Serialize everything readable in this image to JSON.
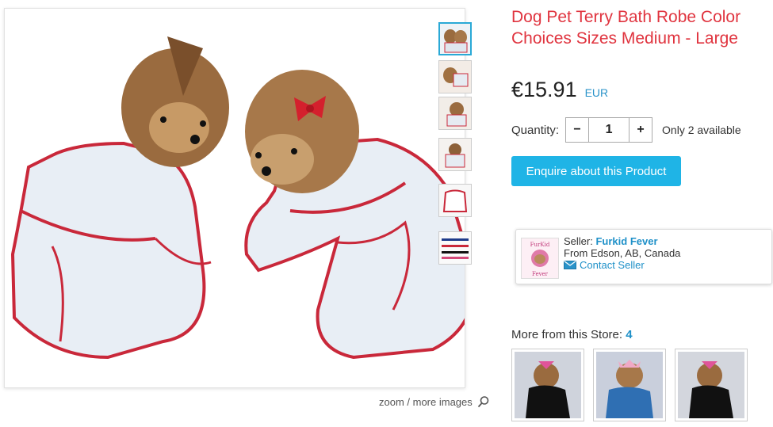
{
  "product": {
    "title": "Dog Pet Terry Bath Robe Color Choices Sizes Medium - Large",
    "price": "€15.91",
    "currency": "EUR",
    "quantity_label": "Quantity:",
    "quantity_value": "1",
    "decrement_label": "−",
    "increment_label": "+",
    "availability": "Only 2 available",
    "enquire_label": "Enquire about this Product"
  },
  "gallery": {
    "zoom_label": "zoom / more images",
    "thumbnail_count": 6,
    "active_thumbnail": 1
  },
  "seller": {
    "label": "Seller:",
    "name": "Furkid Fever",
    "location": "From Edson, AB, Canada",
    "contact_label": "Contact Seller",
    "logo_text_top": "FurKid",
    "logo_text_bottom": "Fever"
  },
  "more": {
    "label": "More from this Store:",
    "count": "4"
  },
  "colors": {
    "title": "#e0343f",
    "accent": "#1fb4e6",
    "link": "#1e90c8"
  }
}
